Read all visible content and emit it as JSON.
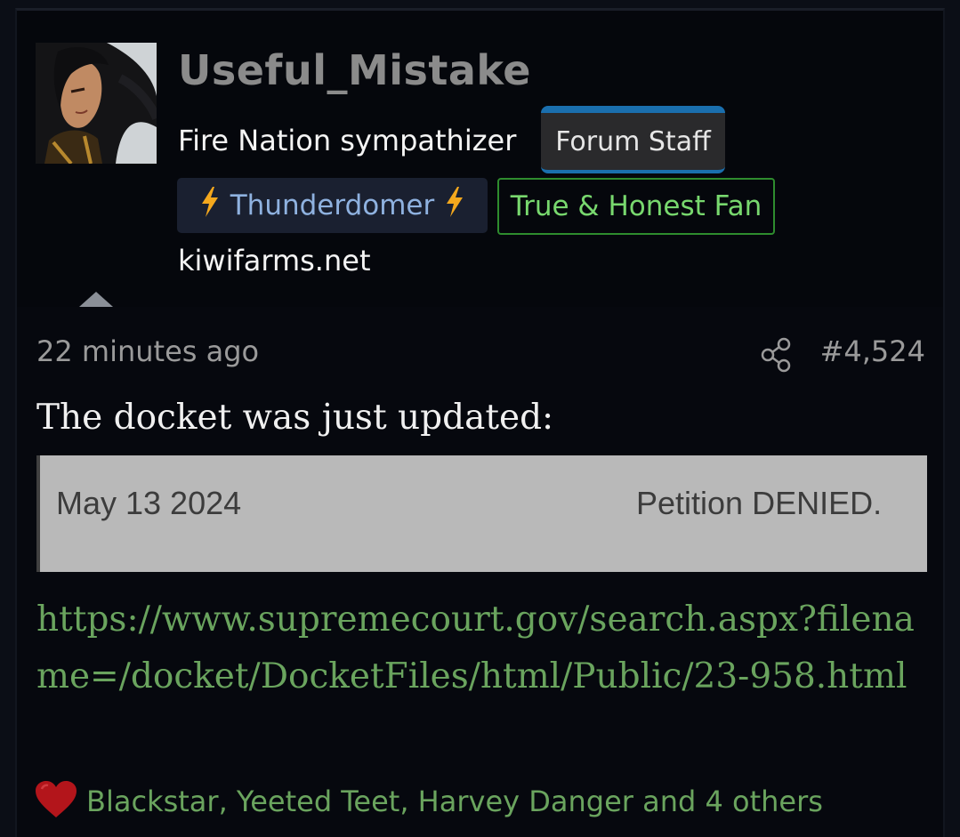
{
  "user": {
    "username": "Useful_Mistake",
    "title": "Fire Nation sympathizer",
    "staff_badge": "Forum Staff",
    "badges": [
      {
        "label": "Thunderdomer",
        "icon": "lightning-bolt-icon",
        "color": "#8fb2e0"
      },
      {
        "label": "True & Honest Fan",
        "color": "#78d86e"
      }
    ],
    "site": "kiwifarms.net",
    "avatar_icon": "avatar-character-portrait"
  },
  "post": {
    "time": "22 minutes ago",
    "number": "#4,524",
    "share_icon": "share-icon",
    "text": "The docket was just updated:",
    "docket": {
      "date": "May 13 2024",
      "status": "Petition DENIED."
    },
    "link": "https://www.supremecourt.gov/search.aspx?filename=/docket/DocketFiles/html/Public/23-958.html"
  },
  "reactions": {
    "icon": "heart-icon",
    "users": "Blackstar, Yeeted Teet, Harvey Danger and 4 others"
  },
  "colors": {
    "background": "#05070c",
    "link": "#6aa45e",
    "staff_accent": "#1a6fae",
    "fan_border": "#2e8c2e",
    "bolt": "#f4a81d",
    "heart": "#b3151b"
  }
}
